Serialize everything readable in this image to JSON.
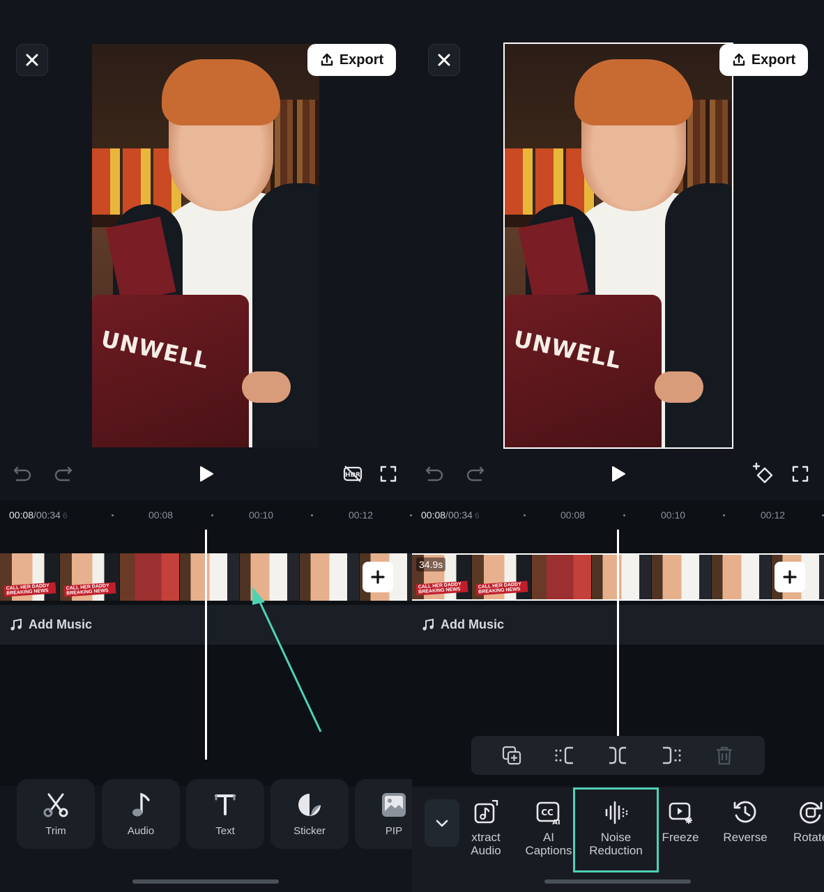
{
  "left": {
    "export_label": "Export",
    "timeline": {
      "current": "00:08",
      "separator": "/",
      "total": "00:34",
      "total_frac": "6",
      "ticks": [
        "00:08",
        "00:10",
        "00:12"
      ]
    },
    "add_music_label": "Add Music",
    "tools": [
      {
        "label": "Trim",
        "icon": "scissors-icon"
      },
      {
        "label": "Audio",
        "icon": "music-note-icon"
      },
      {
        "label": "Text",
        "icon": "text-icon"
      },
      {
        "label": "Sticker",
        "icon": "sticker-icon"
      },
      {
        "label": "PIP",
        "icon": "image-icon"
      }
    ],
    "laptop_text": "UNWELL",
    "clip_tag": "CALL HER DADDY BREAKING NEWS"
  },
  "right": {
    "export_label": "Export",
    "timeline": {
      "current": "00:08",
      "separator": "/",
      "total": "00:34",
      "total_frac": "6",
      "ticks": [
        "00:08",
        "00:10",
        "00:12"
      ]
    },
    "clip_duration": "34.9s",
    "add_music_label": "Add Music",
    "sub_tools": [
      {
        "label_line1": "xtract",
        "label_line2": "Audio",
        "icon": "extract-audio-icon"
      },
      {
        "label_line1": "AI",
        "label_line2": "Captions",
        "icon": "ai-captions-icon"
      },
      {
        "label_line1": "Noise",
        "label_line2": "Reduction",
        "icon": "noise-reduction-icon"
      },
      {
        "label_line1": "Freeze",
        "label_line2": "",
        "icon": "freeze-icon"
      },
      {
        "label_line1": "Reverse",
        "label_line2": "",
        "icon": "reverse-icon"
      },
      {
        "label_line1": "Rotate",
        "label_line2": "",
        "icon": "rotate-icon"
      }
    ],
    "laptop_text": "UNWELL",
    "clip_tag": "CALL HER DADDY BREAKING NEWS"
  },
  "colors": {
    "highlight": "#4fd1b4",
    "background": "#12161c",
    "panel": "#1b2027"
  }
}
